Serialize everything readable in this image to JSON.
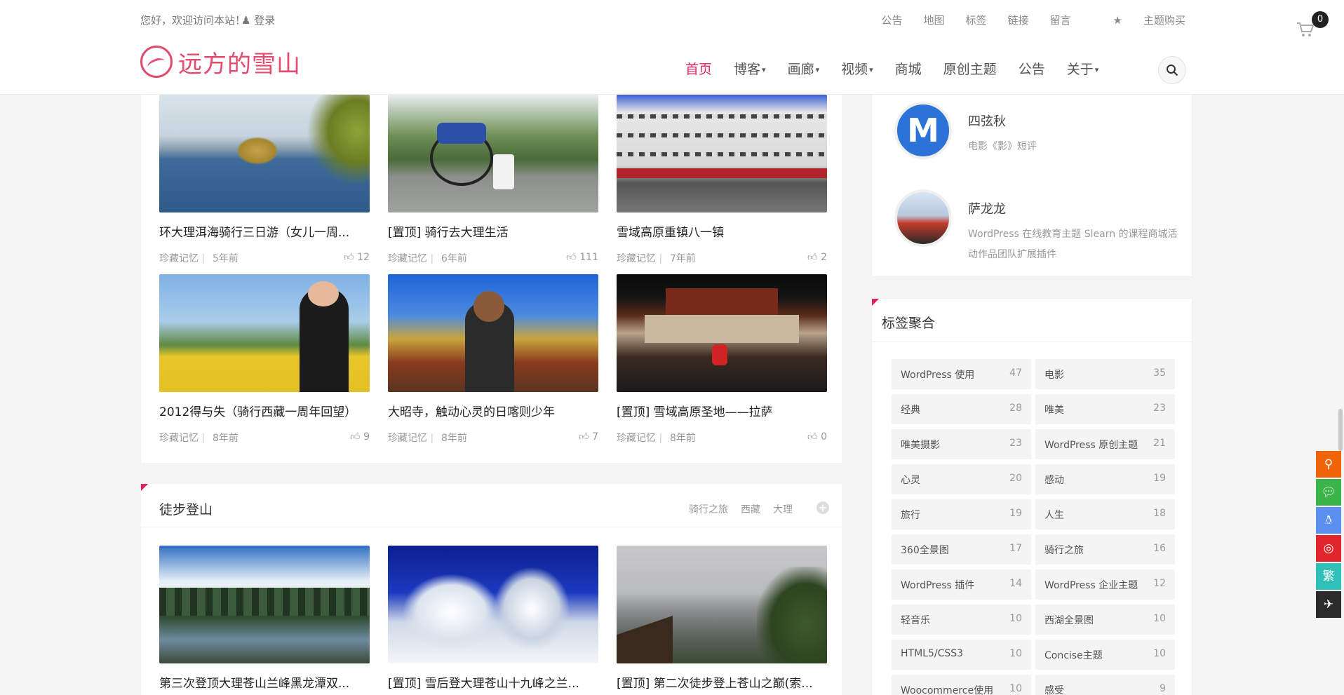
{
  "topbar": {
    "welcome": "您好，欢迎访问本站！",
    "login": "登录",
    "links": [
      "公告",
      "地图",
      "标签",
      "链接",
      "留言"
    ],
    "buy": "主题购买"
  },
  "cart": {
    "count": "0"
  },
  "logo": {
    "text": "远方的雪山"
  },
  "nav": [
    {
      "label": "首页",
      "dropdown": false,
      "active": true
    },
    {
      "label": "博客",
      "dropdown": true
    },
    {
      "label": "画廊",
      "dropdown": true
    },
    {
      "label": "视频",
      "dropdown": true
    },
    {
      "label": "商城",
      "dropdown": false
    },
    {
      "label": "原创主题",
      "dropdown": false
    },
    {
      "label": "公告",
      "dropdown": false
    },
    {
      "label": "关于",
      "dropdown": true
    }
  ],
  "posts": [
    {
      "title": "环大理洱海骑行三日游（女儿一周...",
      "category": "珍藏记忆",
      "time": "5年前",
      "likes": "12"
    },
    {
      "title": "[置顶] 骑行去大理生活",
      "category": "珍藏记忆",
      "time": "6年前",
      "likes": "111"
    },
    {
      "title": "雪域高原重镇八一镇",
      "category": "珍藏记忆",
      "time": "7年前",
      "likes": "2"
    },
    {
      "title": "2012得与失（骑行西藏一周年回望）",
      "category": "珍藏记忆",
      "time": "8年前",
      "likes": "9"
    },
    {
      "title": "大昭寺，触动心灵的日喀则少年",
      "category": "珍藏记忆",
      "time": "8年前",
      "likes": "7"
    },
    {
      "title": "[置顶] 雪域高原圣地——拉萨",
      "category": "珍藏记忆",
      "time": "8年前",
      "likes": "0"
    }
  ],
  "hiking": {
    "title": "徒步登山",
    "tags": [
      "骑行之旅",
      "西藏",
      "大理"
    ],
    "posts": [
      {
        "title": "第三次登顶大理苍山兰峰黑龙潭双..."
      },
      {
        "title": "[置顶] 雪后登大理苍山十九峰之兰..."
      },
      {
        "title": "[置顶] 第二次徒步登上苍山之巅(索..."
      }
    ]
  },
  "comments": [
    {
      "name": "四弦秋",
      "text": "电影《影》短评",
      "avatar_letter": "M"
    },
    {
      "name": "萨龙龙",
      "text": "WordPress 在线教育主题 Slearn 的课程商城活动作品团队扩展插件"
    }
  ],
  "tag_widget": {
    "title": "标签聚合",
    "tags": [
      {
        "name": "WordPress 使用",
        "count": "47"
      },
      {
        "name": "电影",
        "count": "35"
      },
      {
        "name": "经典",
        "count": "28"
      },
      {
        "name": "唯美",
        "count": "23"
      },
      {
        "name": "唯美摄影",
        "count": "23"
      },
      {
        "name": "WordPress 原创主题",
        "count": "21"
      },
      {
        "name": "心灵",
        "count": "20"
      },
      {
        "name": "感动",
        "count": "19"
      },
      {
        "name": "旅行",
        "count": "19"
      },
      {
        "name": "人生",
        "count": "18"
      },
      {
        "name": "360全景图",
        "count": "17"
      },
      {
        "name": "骑行之旅",
        "count": "16"
      },
      {
        "name": "WordPress 插件",
        "count": "14"
      },
      {
        "name": "WordPress 企业主题",
        "count": "12"
      },
      {
        "name": "轻音乐",
        "count": "10"
      },
      {
        "name": "西湖全景图",
        "count": "10"
      },
      {
        "name": "HTML5/CSS3",
        "count": "10"
      },
      {
        "name": "Concise主题",
        "count": "10"
      },
      {
        "name": "Woocommerce使用",
        "count": "10"
      },
      {
        "name": "感受",
        "count": "9"
      }
    ]
  },
  "floatbar": {
    "colors": [
      "#f0640a",
      "#3bb44a",
      "#5b8ff0",
      "#e0262a",
      "#2fc0b8",
      "#2a2a2a"
    ],
    "icons": [
      "search-icon",
      "wechat-icon",
      "qq-icon",
      "weibo-icon",
      "traditional-chinese-icon",
      "airplane-icon"
    ],
    "trad_label": "繁"
  },
  "colors": {
    "accent": "#e0225a",
    "logo": "#e34a6c"
  }
}
